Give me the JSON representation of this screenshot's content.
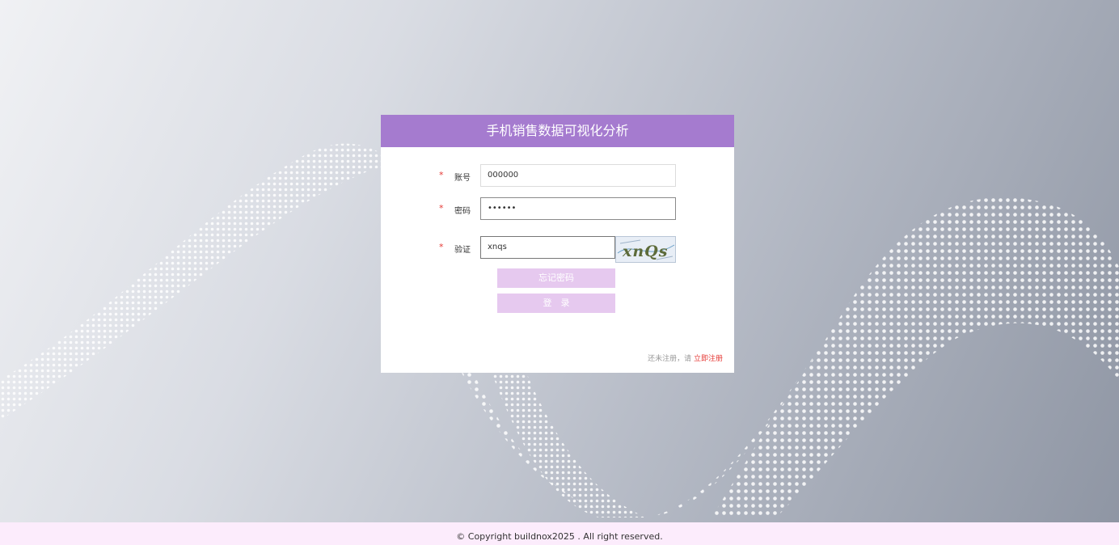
{
  "app": {
    "title": "手机销售数据可视化分析"
  },
  "form": {
    "account": {
      "label": "账号",
      "value": "000000"
    },
    "password": {
      "label": "密码",
      "value": "••••••"
    },
    "captcha": {
      "label": "验证",
      "value": "xnqs",
      "image_text": "xnQs"
    },
    "required_mark": "*"
  },
  "buttons": {
    "forgot": "忘记密码",
    "login": "登　录"
  },
  "register": {
    "prompt": "还未注册，请",
    "link": "立即注册"
  },
  "footer": {
    "text": "© Copyright buildnox2025 . All right reserved."
  },
  "colors": {
    "header": "#a57bcf",
    "button": "#e6c9ef",
    "footer": "#fcecfc",
    "required": "#e53935"
  }
}
